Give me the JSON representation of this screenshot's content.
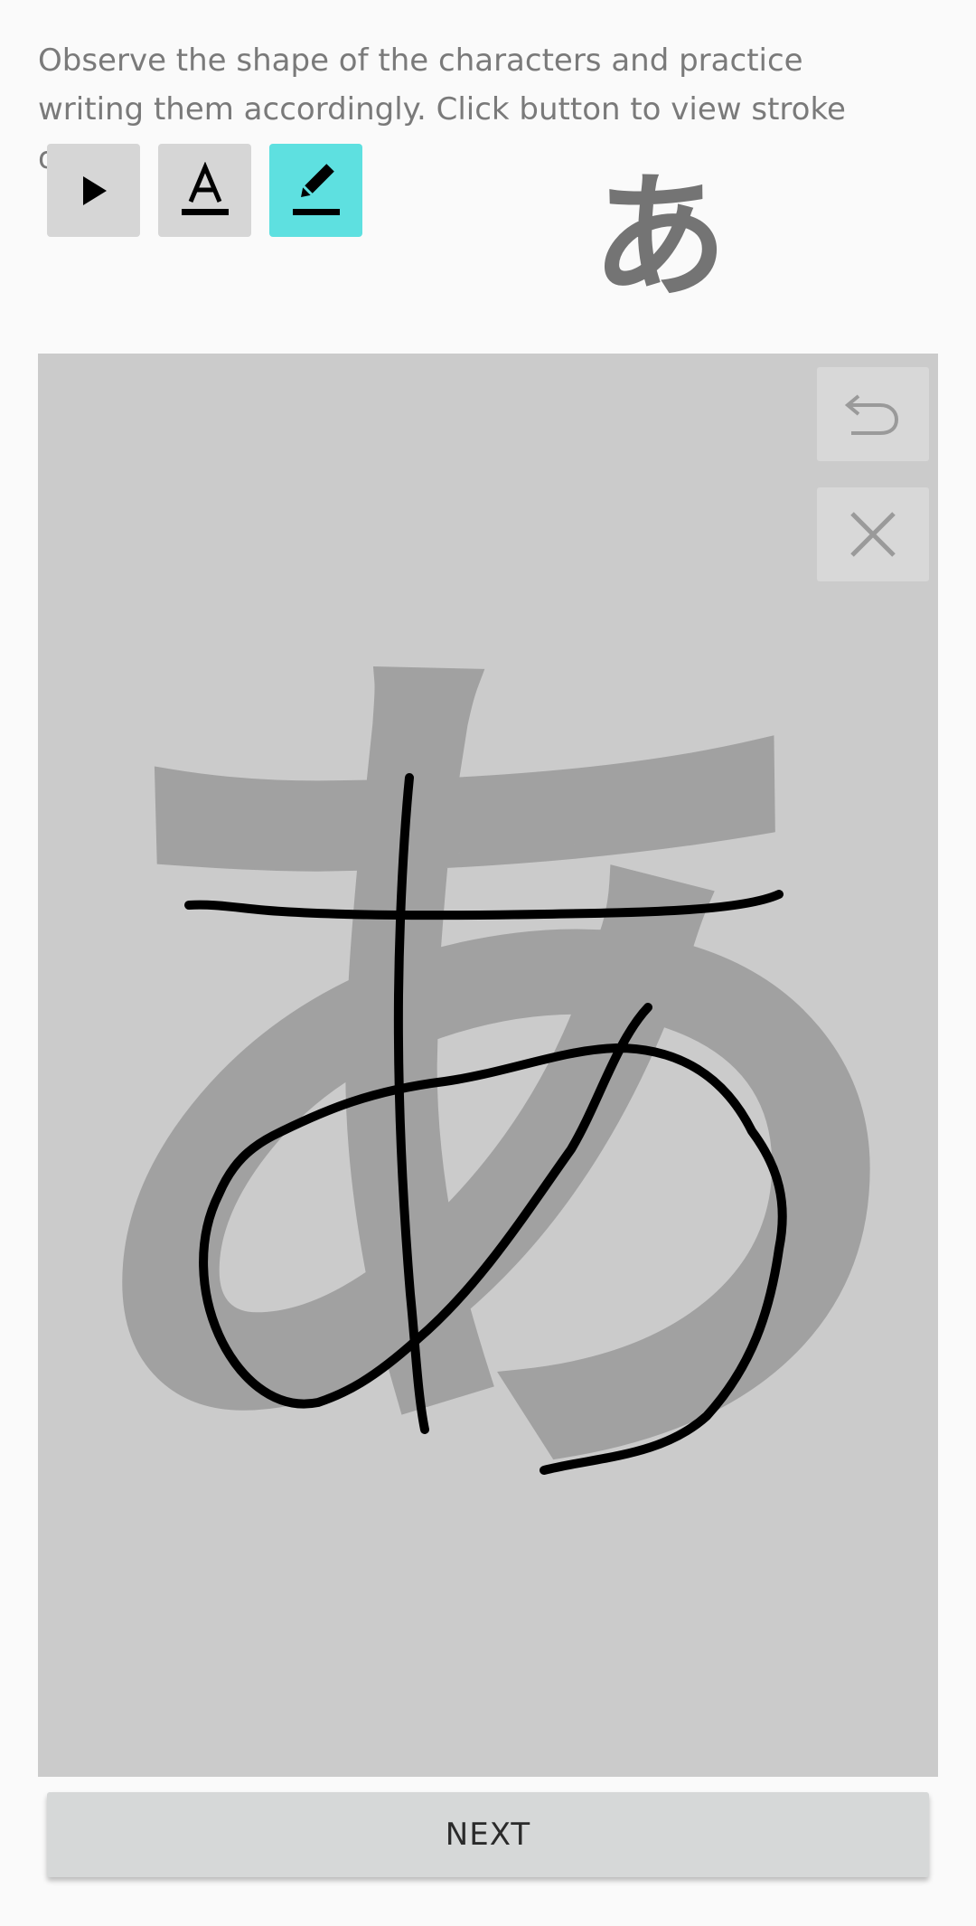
{
  "instructions": "Observe the shape of the characters and practice writing them accordingly. Click button to view stroke order.",
  "toolbar": {
    "play_icon": "play-icon",
    "outline_icon": "text-a-underline-icon",
    "draw_icon": "pencil-icon",
    "active_color": "#5ee0e0",
    "button_color": "#d6d6d6"
  },
  "character": "あ",
  "canvas": {
    "background": "#cbcbcb",
    "guide_color": "#a1a1a1",
    "undo_icon": "undo-icon",
    "clear_icon": "close-icon"
  },
  "next_label": "NEXT"
}
